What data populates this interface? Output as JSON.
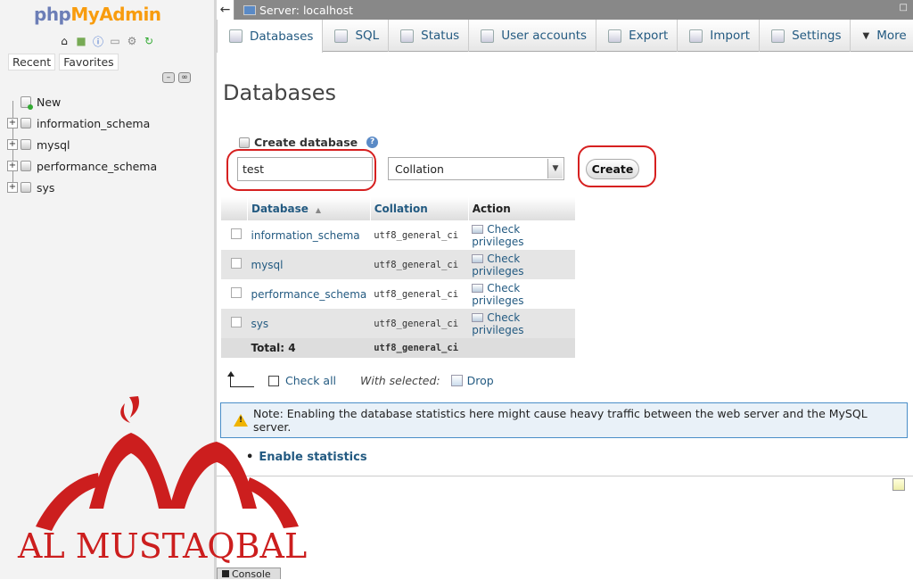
{
  "app": {
    "logo_php": "php",
    "logo_myadmin": "MyAdmin"
  },
  "nav": {
    "buttons": [
      "Recent",
      "Favorites"
    ],
    "new_label": "New",
    "databases": [
      "information_schema",
      "mysql",
      "performance_schema",
      "sys"
    ]
  },
  "topbar": {
    "back": "←",
    "server_label": "Server: localhost"
  },
  "tabs": [
    {
      "label": "Databases",
      "icon": "database-icon",
      "active": true
    },
    {
      "label": "SQL",
      "icon": "sql-icon"
    },
    {
      "label": "Status",
      "icon": "status-icon"
    },
    {
      "label": "User accounts",
      "icon": "users-icon"
    },
    {
      "label": "Export",
      "icon": "export-icon"
    },
    {
      "label": "Import",
      "icon": "import-icon"
    },
    {
      "label": "Settings",
      "icon": "wrench-icon"
    },
    {
      "label": "More",
      "icon": "chevron-down-icon"
    }
  ],
  "main": {
    "title": "Databases",
    "create_label": "Create database",
    "db_name_value": "test",
    "collation_value": "Collation",
    "create_button": "Create"
  },
  "table": {
    "headers": [
      "Database",
      "Collation",
      "Action"
    ],
    "rows": [
      {
        "name": "information_schema",
        "collation": "utf8_general_ci",
        "action": "Check privileges"
      },
      {
        "name": "mysql",
        "collation": "utf8_general_ci",
        "action": "Check privileges"
      },
      {
        "name": "performance_schema",
        "collation": "utf8_general_ci",
        "action": "Check privileges"
      },
      {
        "name": "sys",
        "collation": "utf8_general_ci",
        "action": "Check privileges"
      }
    ],
    "total_label": "Total: 4",
    "total_collation": "utf8_general_ci"
  },
  "bulk": {
    "check_all": "Check all",
    "with_selected": "With selected:",
    "drop": "Drop"
  },
  "note": "Note: Enabling the database statistics here might cause heavy traffic between the web server and the MySQL server.",
  "enable_statistics": "Enable statistics",
  "console": "Console",
  "watermark": {
    "text": "AL MUSTAQBAL",
    "color": "#cc1e1e"
  },
  "colors": {
    "link": "#235a81",
    "highlight": "#d62020",
    "note_border": "#4a8ec8"
  }
}
